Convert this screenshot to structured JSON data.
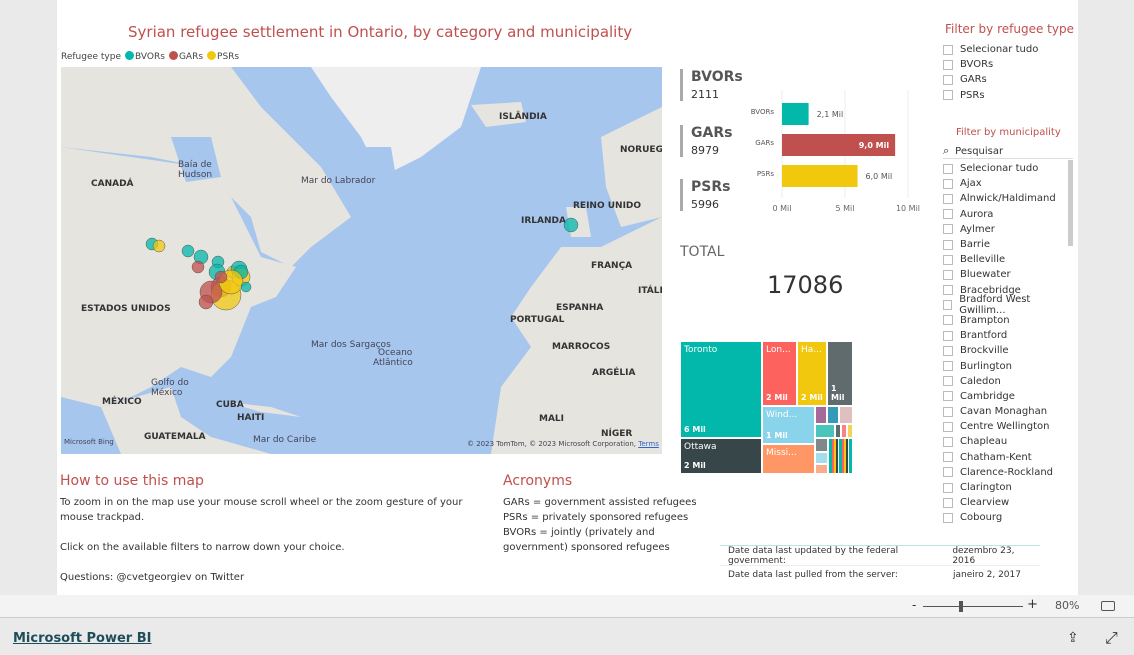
{
  "title": "Syrian refugee settlement in Ontario, by category and municipality",
  "legend": {
    "label": "Refugee type",
    "items": [
      {
        "name": "BVORs",
        "color": "#01B8AA"
      },
      {
        "name": "GARs",
        "color": "#C0504D"
      },
      {
        "name": "PSRs",
        "color": "#F2C80F"
      }
    ]
  },
  "map": {
    "labels": [
      "ISLÂNDIA",
      "CANADÁ",
      "Baía de",
      "Hudson",
      "Mar do Labrador",
      "NORUEGA",
      "REINO UNIDO",
      "IRLANDA",
      "FRANÇA",
      "ESPANHA",
      "PORTUGAL",
      "ITÁLIA",
      "MARROCOS",
      "ARGÉLIA",
      "Oceano",
      "Atlântico",
      "Mar dos Sargaços",
      "ESTADOS UNIDOS",
      "Golfo do",
      "México",
      "MÉXICO",
      "CUBA",
      "HAITI",
      "GUATEMALA",
      "Mar do Caribe",
      "MALI",
      "NÍGER"
    ],
    "copyright": "© 2023 TomTom, © 2023 Microsoft Corporation,",
    "terms": "Terms",
    "bing": "Microsoft Bing"
  },
  "cards": [
    {
      "label": "BVORs",
      "value": "2111"
    },
    {
      "label": "GARs",
      "value": "8979"
    },
    {
      "label": "PSRs",
      "value": "5996"
    }
  ],
  "chart_data": {
    "type": "bar",
    "orientation": "horizontal",
    "categories": [
      "BVORs",
      "GARs",
      "PSRs"
    ],
    "values": [
      2111,
      8979,
      5996
    ],
    "data_labels": [
      "2,1 Mil",
      "9,0 Mil",
      "6,0 Mil"
    ],
    "xticks": [
      "0 Mil",
      "5 Mil",
      "10 Mil"
    ],
    "xlim": [
      0,
      10000
    ],
    "colors": [
      "#01B8AA",
      "#C0504D",
      "#F2C80F"
    ],
    "grid": true
  },
  "total": {
    "label": "TOTAL",
    "value": "17086"
  },
  "treemap": [
    {
      "name": "Toronto",
      "value": "6 Mil",
      "color": "#01B8AA"
    },
    {
      "name": "Ottawa",
      "value": "2 Mil",
      "color": "#374649"
    },
    {
      "name": "Lon...",
      "value": "2 Mil",
      "color": "#FD625E"
    },
    {
      "name": "Ha...",
      "value": "2 Mil",
      "color": "#F2C80F"
    },
    {
      "name": "",
      "value": "1 Mil",
      "color": "#5F6B6D"
    },
    {
      "name": "Wind...",
      "value": "1 Mil",
      "color": "#8AD4EB"
    },
    {
      "name": "Missi...",
      "value": "",
      "color": "#FE9666"
    }
  ],
  "howto": {
    "heading": "How to use this map",
    "p1": "To zoom in on the map use your mouse scroll wheel or the zoom gesture of your mouse trackpad.",
    "p2": "Click on the available filters to narrow down your choice.",
    "p3": "Questions: @cvetgeorgiev on Twitter"
  },
  "acronyms": {
    "heading": "Acronyms",
    "lines": [
      {
        "k": "GARs",
        "v": " =  government assisted refugees"
      },
      {
        "k": "PSRs",
        "v": " = privately sponsored refugees"
      },
      {
        "k": "BVORs",
        "v": " = jointly (privately and government) sponsored refugees"
      }
    ]
  },
  "dates": [
    {
      "label": "Date data last updated by the federal government:",
      "value": "dezembro 23, 2016"
    },
    {
      "label": "Date data last pulled from the server:",
      "value": "janeiro 2, 2017"
    }
  ],
  "filter_type": {
    "title": "Filter by refugee type",
    "items": [
      "Selecionar tudo",
      "BVORs",
      "GARs",
      "PSRs"
    ]
  },
  "filter_muni": {
    "title": "Filter by municipality",
    "search_placeholder": "Pesquisar",
    "items": [
      "Selecionar tudo",
      "Ajax",
      "Alnwick/Haldimand",
      "Aurora",
      "Aylmer",
      "Barrie",
      "Belleville",
      "Bluewater",
      "Bracebridge",
      "Bradford West Gwillim...",
      "Brampton",
      "Brantford",
      "Brockville",
      "Burlington",
      "Caledon",
      "Cambridge",
      "Cavan Monaghan",
      "Centre Wellington",
      "Chapleau",
      "Chatham-Kent",
      "Clarence-Rockland",
      "Clarington",
      "Clearview",
      "Cobourg"
    ]
  },
  "zoom": {
    "minus": "-",
    "plus": "+",
    "level": "80%",
    "value": 80
  },
  "brand": "Microsoft Power BI"
}
